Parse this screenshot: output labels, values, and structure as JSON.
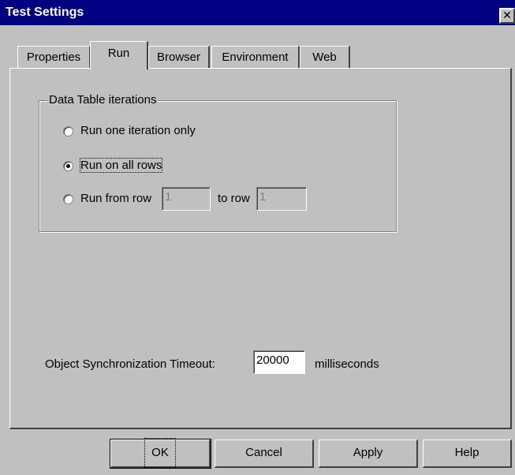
{
  "window": {
    "title": "Test Settings",
    "close_glyph": "✕"
  },
  "tabs": [
    {
      "label": "Properties",
      "active": false
    },
    {
      "label": "Run",
      "active": true
    },
    {
      "label": "Browser",
      "active": false
    },
    {
      "label": "Environment",
      "active": false
    },
    {
      "label": "Web",
      "active": false
    }
  ],
  "run": {
    "group_label": "Data Table iterations",
    "options": [
      {
        "label": "Run one iteration only",
        "checked": false
      },
      {
        "label": "Run on all rows",
        "checked": true
      },
      {
        "label": "Run from row",
        "checked": false
      }
    ],
    "from_row_value": "1",
    "to_row_label": "to row",
    "to_row_value": "1",
    "timeout_label": "Object Synchronization Timeout:",
    "timeout_value": "20000",
    "timeout_unit": "milliseconds"
  },
  "buttons": {
    "ok": "OK",
    "cancel": "Cancel",
    "apply": "Apply",
    "help": "Help"
  }
}
